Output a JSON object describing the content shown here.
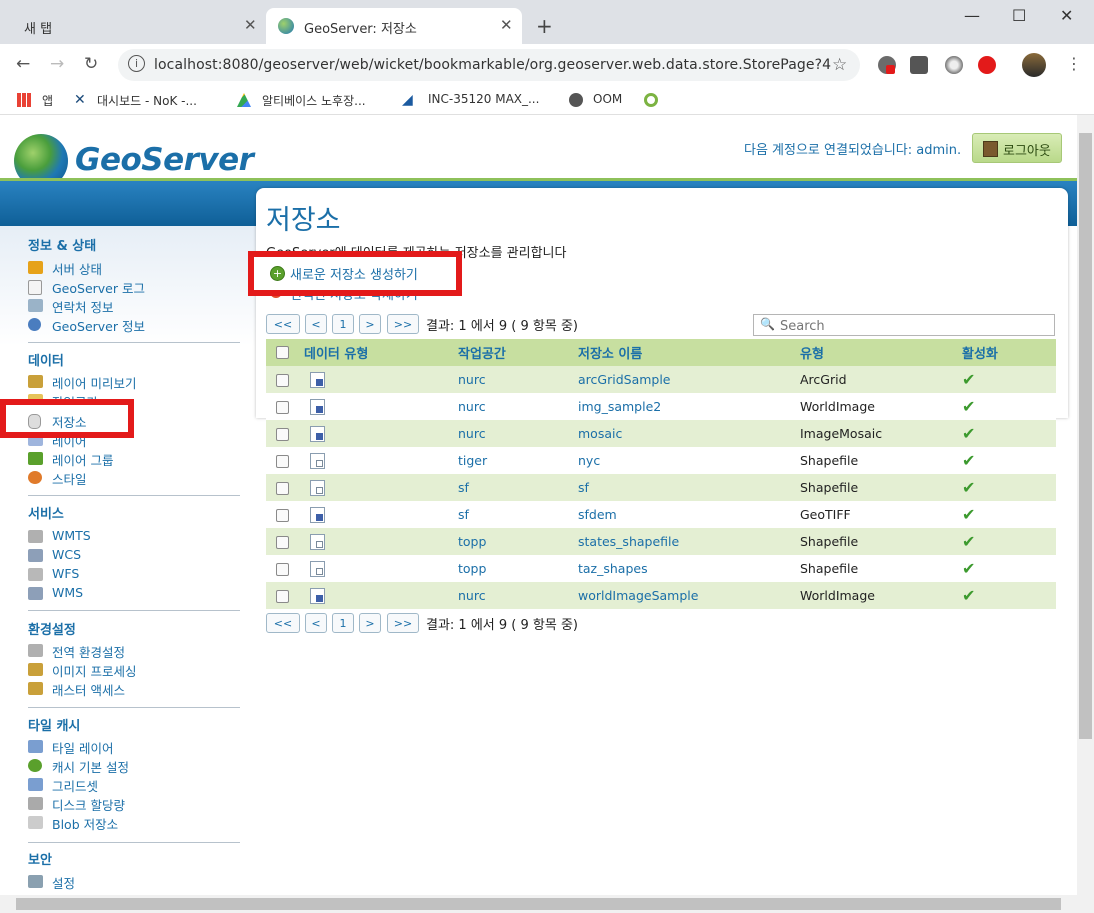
{
  "browser": {
    "tabs": [
      {
        "title": "새 탭",
        "close": "✕"
      },
      {
        "title": "GeoServer: 저장소",
        "close": "✕"
      }
    ],
    "new_tab": "+",
    "window_controls": {
      "minimize": "—",
      "maximize": "☐",
      "close": "✕"
    },
    "url": "localhost:8080/geoserver/web/wicket/bookmarkable/org.geoserver.web.data.store.StorePage?4",
    "bookmarks": [
      {
        "label": "앱",
        "icon": "apps-grid-icon"
      },
      {
        "label": "대시보드 - NoK -...",
        "icon": "tools-icon"
      },
      {
        "label": "알티베이스 노후장...",
        "icon": "drive-icon"
      },
      {
        "label": "INC-35120  MAX_...",
        "icon": "jira-icon"
      },
      {
        "label": "OOM",
        "icon": "globe-icon"
      },
      {
        "label": "",
        "icon": "qgis-icon"
      }
    ],
    "extensions": [
      "extension-badge-icon",
      "extension-i-icon",
      "extension-circle-icon",
      "adblock-icon",
      "avatar",
      "menu-icon"
    ]
  },
  "header": {
    "logo_text": "GeoServer",
    "account_text": "다음 계정으로 연결되었습니다: admin.",
    "logout_label": "로그아웃"
  },
  "sidebar": {
    "sections": [
      {
        "title": "정보 & 상태",
        "items": [
          "서버 상태",
          "GeoServer 로그",
          "연락처 정보",
          "GeoServer 정보"
        ]
      },
      {
        "title": "데이터",
        "items": [
          "레이어 미리보기",
          "작업공간",
          "저장소",
          "레이어",
          "레이어 그룹",
          "스타일"
        ]
      },
      {
        "title": "서비스",
        "items": [
          "WMTS",
          "WCS",
          "WFS",
          "WMS"
        ]
      },
      {
        "title": "환경설정",
        "items": [
          "전역 환경설정",
          "이미지 프로세싱",
          "래스터 액세스"
        ]
      },
      {
        "title": "타일 캐시",
        "items": [
          "타일 레이어",
          "캐시 기본 설정",
          "그리드셋",
          "디스크 할당량",
          "Blob 저장소"
        ]
      },
      {
        "title": "보안",
        "items": [
          "설정"
        ]
      }
    ]
  },
  "main": {
    "title": "저장소",
    "description": "GeoServer에 데이터를 제공하는 저장소를 관리합니다",
    "add_link": "새로운 저장소 생성하기",
    "remove_link": "선택된 저장소 삭제하기",
    "pager": {
      "first": "<<",
      "prev": "<",
      "page": "1",
      "next": ">",
      "last": ">>",
      "result": "결과: 1 에서 9 ( 9 항목 중)"
    },
    "search_placeholder": "Search",
    "columns": [
      "데이터 유형",
      "작업공간",
      "저장소 이름",
      "유형",
      "활성화"
    ],
    "rows": [
      {
        "workspace": "nurc",
        "name": "arcGridSample",
        "type": "ArcGrid",
        "enabled": "✔"
      },
      {
        "workspace": "nurc",
        "name": "img_sample2",
        "type": "WorldImage",
        "enabled": "✔"
      },
      {
        "workspace": "nurc",
        "name": "mosaic",
        "type": "ImageMosaic",
        "enabled": "✔"
      },
      {
        "workspace": "tiger",
        "name": "nyc",
        "type": "Shapefile",
        "enabled": "✔"
      },
      {
        "workspace": "sf",
        "name": "sf",
        "type": "Shapefile",
        "enabled": "✔"
      },
      {
        "workspace": "sf",
        "name": "sfdem",
        "type": "GeoTIFF",
        "enabled": "✔"
      },
      {
        "workspace": "topp",
        "name": "states_shapefile",
        "type": "Shapefile",
        "enabled": "✔"
      },
      {
        "workspace": "topp",
        "name": "taz_shapes",
        "type": "Shapefile",
        "enabled": "✔"
      },
      {
        "workspace": "nurc",
        "name": "worldImageSample",
        "type": "WorldImage",
        "enabled": "✔"
      }
    ]
  },
  "colors": {
    "accent": "#1b6fa8",
    "header_band": "#0f5f97",
    "table_header": "#c7dfa0",
    "row_alt": "#e4efd3",
    "highlight": "#e31a1a"
  }
}
